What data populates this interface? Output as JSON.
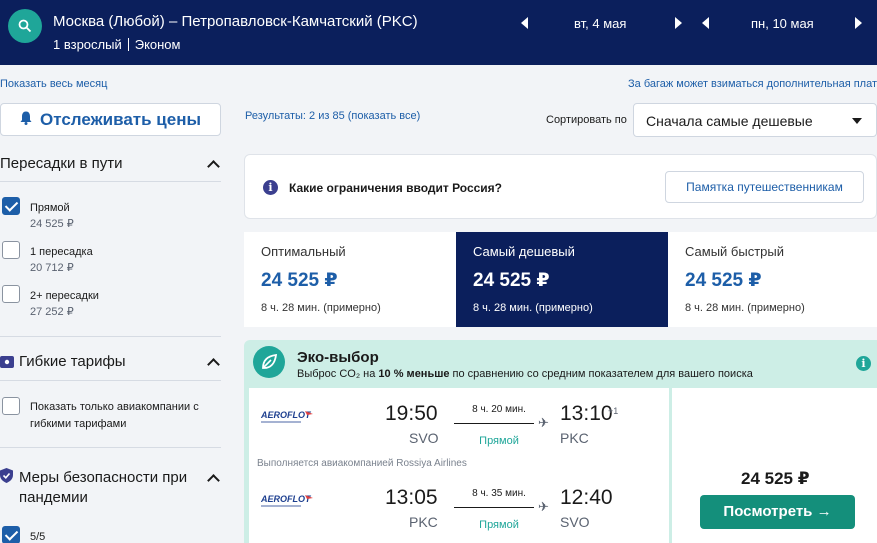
{
  "header": {
    "route": "Москва (Любой) – Петропавловск-Камчатский (PKC)",
    "passengers": "1 взрослый",
    "cabin": "Эконом",
    "date_out": "вт, 4 мая",
    "date_back": "пн, 10 мая"
  },
  "links": {
    "show_month": "Показать весь месяц",
    "baggage_note": "За багаж может взиматься дополнительная плата"
  },
  "sidebar": {
    "track_label": "Отслеживать цены",
    "stops_title": "Пересадки в пути",
    "stops_options": [
      {
        "label": "Прямой",
        "price": "24 525 ₽",
        "checked": true
      },
      {
        "label": "1 пересадка",
        "price": "20 712 ₽",
        "checked": false
      },
      {
        "label": "2+ пересадки",
        "price": "27 252 ₽",
        "checked": false
      }
    ],
    "flex_title": "Гибкие тарифы",
    "flex_option": "Показать только авиакомпании с гибкими тарифами",
    "safety_title": "Меры безопасности при пандемии",
    "safety_option": "5/5"
  },
  "results": {
    "count_text": "Результаты: 2 из 85 (показать все)",
    "sort_label": "Сортировать по",
    "sort_value": "Сначала самые дешевые"
  },
  "info_card": {
    "question": "Какие ограничения вводит Россия?",
    "button": "Памятка путешественникам"
  },
  "tabs": [
    {
      "name": "Оптимальный",
      "price": "24 525 ₽",
      "duration": "8 ч. 28 мин. (примерно)"
    },
    {
      "name": "Самый дешевый",
      "price": "24 525 ₽",
      "duration": "8 ч. 28 мин. (примерно)"
    },
    {
      "name": "Самый быстрый",
      "price": "24 525 ₽",
      "duration": "8 ч. 28 мин. (примерно)"
    }
  ],
  "eco": {
    "title": "Эко-выбор",
    "sub_prefix": "Выброс CO₂ на ",
    "sub_bold": "10 % меньше",
    "sub_suffix": " по сравнению со средним показателем для вашего поиска"
  },
  "flight": {
    "outbound": {
      "dep_time": "19:50",
      "dep_code": "SVO",
      "duration": "8 ч. 20 мин.",
      "stops": "Прямой",
      "arr_time": "13:10",
      "arr_plus": "+1",
      "arr_code": "PKC"
    },
    "operated_by": "Выполняется авиакомпанией Rossiya Airlines",
    "inbound": {
      "dep_time": "13:05",
      "dep_code": "PKC",
      "duration": "8 ч. 35 мин.",
      "stops": "Прямой",
      "arr_time": "12:40",
      "arr_code": "SVO"
    },
    "price": "24 525 ₽",
    "view_button": "Посмотреть →"
  },
  "colors": {
    "header_bg": "#0b1f5c",
    "accent_teal": "#1fa699",
    "link_blue": "#1d5ea8",
    "eco_bg": "#cdeee6"
  }
}
